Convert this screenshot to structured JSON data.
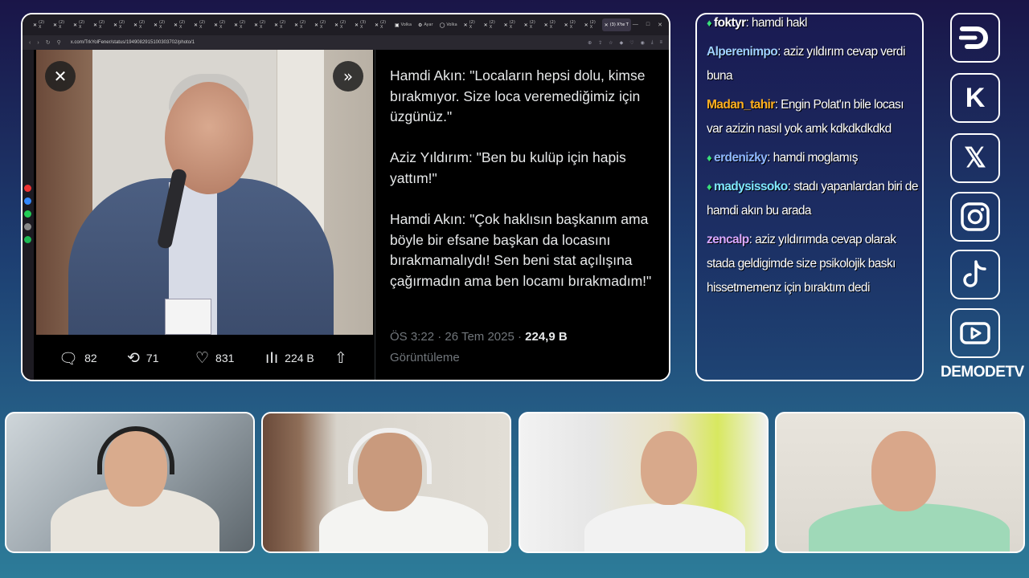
{
  "browser": {
    "tabs": [
      {
        "label": "(2) X",
        "icon": "x-logo-icon"
      },
      {
        "label": "(2) X",
        "icon": "x-logo-icon"
      },
      {
        "label": "(2) X",
        "icon": "x-logo-icon"
      },
      {
        "label": "(2) X",
        "icon": "x-logo-icon"
      },
      {
        "label": "(2) X",
        "icon": "x-logo-icon"
      },
      {
        "label": "(2) X",
        "icon": "x-logo-icon"
      },
      {
        "label": "(2) X",
        "icon": "x-logo-icon"
      },
      {
        "label": "(2) X",
        "icon": "x-logo-icon"
      },
      {
        "label": "(2) X",
        "icon": "x-logo-icon"
      },
      {
        "label": "(2) X",
        "icon": "x-logo-icon"
      },
      {
        "label": "(2) X",
        "icon": "x-logo-icon"
      },
      {
        "label": "(2) X",
        "icon": "x-logo-icon"
      },
      {
        "label": "(2) X",
        "icon": "x-logo-icon"
      },
      {
        "label": "(2) X",
        "icon": "x-logo-icon"
      },
      {
        "label": "(2) X",
        "icon": "x-logo-icon"
      },
      {
        "label": "(2) X",
        "icon": "x-logo-icon"
      },
      {
        "label": "(3) X",
        "icon": "x-logo-icon"
      },
      {
        "label": "(2) X",
        "icon": "x-logo-icon"
      },
      {
        "label": "Volka",
        "icon": "twitch-icon"
      },
      {
        "label": "Ayar",
        "icon": "gear-icon"
      },
      {
        "label": "Volka",
        "icon": "globe-icon"
      },
      {
        "label": "(2) X",
        "icon": "x-logo-icon"
      },
      {
        "label": "(2) X",
        "icon": "x-logo-icon"
      },
      {
        "label": "(2) X",
        "icon": "x-logo-icon"
      },
      {
        "label": "(2) X",
        "icon": "x-logo-icon"
      },
      {
        "label": "(2) X",
        "icon": "x-logo-icon"
      },
      {
        "label": "(2) X",
        "icon": "x-logo-icon"
      },
      {
        "label": "(2) X",
        "icon": "x-logo-icon"
      },
      {
        "label": "(3) X'te T",
        "icon": "x-logo-icon",
        "active": true
      }
    ],
    "url": "x.com/TrkYolFener/status/1949082915100303702/photo/1"
  },
  "tweet": {
    "text": "Hamdi Akın: \"Locaların hepsi dolu, kimse bırakmıyor. Size loca veremediğimiz için üzgünüz.\"\n\nAziz Yıldırım: \"Ben bu kulüp için hapis yattım!\"\n\nHamdi Akın: \"Çok haklısın başkanım ama böyle bir efsane başkan da locasını bırakmamalıydı! Sen beni stat açılışına çağırmadın ama ben locamı bırakmadım!\"",
    "time": "ÖS 3:22 · 26 Tem 2025 ·",
    "views": "224,9 B",
    "views_label": "Görüntüleme",
    "actions": {
      "replies": "82",
      "reposts": "71",
      "likes": "831",
      "view_count": "224 B"
    }
  },
  "chat": {
    "messages": [
      {
        "user": "foktyr",
        "text": ": hamdi hakl",
        "color": "#ffffff",
        "gem": true,
        "cut": true
      },
      {
        "user": "Alperenimpo",
        "text": ": aziz yıldırım cevap verdi buna",
        "color": "#9fd0ff"
      },
      {
        "user": "Madan_tahir",
        "text": ": Engin Polat'ın bile locası var azizin nasıl yok amk kdkdkdkdkd",
        "color": "#ffb020"
      },
      {
        "user": "erdenizky",
        "text": ": hamdi moglamış",
        "color": "#8fb8ff",
        "gem": true
      },
      {
        "user": "madysissoko",
        "text": ": stadı yapanlardan biri de hamdi akın bu arada",
        "color": "#7fe6ff",
        "gem": true
      },
      {
        "user": "zencalp",
        "text": ": aziz yıldırımda cevap olarak stada geldigimde size psikolojik baskı hissetmemenz için bıraktım dedi",
        "color": "#d9a8ff"
      }
    ]
  },
  "socials": {
    "brand": "DEMODETV",
    "items": [
      "demodetv-logo-icon",
      "kick-icon",
      "x-logo-icon",
      "instagram-icon",
      "tiktok-icon",
      "youtube-icon"
    ],
    "kick_letter": "K",
    "x_letter": "𝕏"
  }
}
